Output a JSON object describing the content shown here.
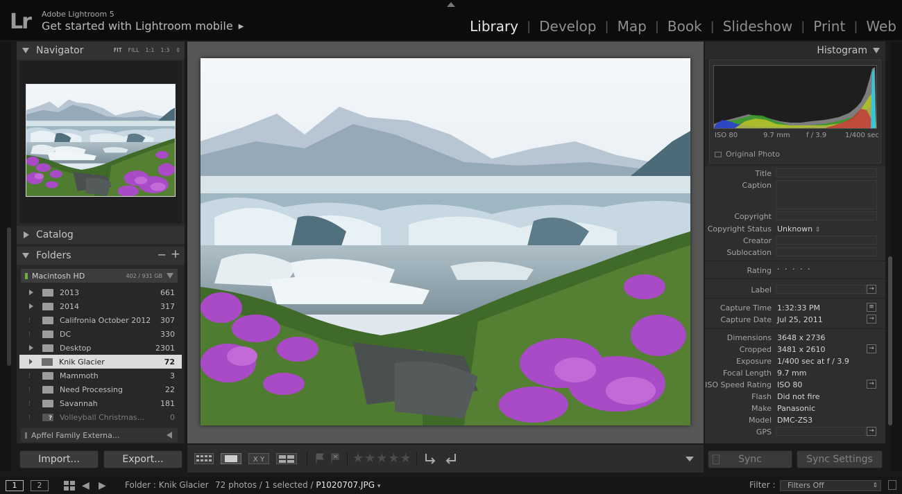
{
  "app": {
    "logo": "Lr",
    "version": "Adobe Lightroom 5",
    "mobile_link": "Get started with Lightroom mobile",
    "mobile_arrow": "▶"
  },
  "modules": {
    "library": "Library",
    "develop": "Develop",
    "map": "Map",
    "book": "Book",
    "slideshow": "Slideshow",
    "print": "Print",
    "web": "Web",
    "active": "Library"
  },
  "navigator": {
    "title": "Navigator",
    "zoom": [
      "FIT",
      "FILL",
      "1:1",
      "1:3"
    ],
    "zoom_active": "FIT"
  },
  "catalog": {
    "title": "Catalog"
  },
  "folders": {
    "title": "Folders",
    "minus": "−",
    "plus": "+",
    "volume": {
      "name": "Macintosh HD",
      "capacity": "402 / 931 GB"
    },
    "items": [
      {
        "name": "2013",
        "count": "661",
        "expandable": true
      },
      {
        "name": "2014",
        "count": "317",
        "expandable": true
      },
      {
        "name": "Califronia October 2012",
        "count": "307",
        "expandable": false
      },
      {
        "name": "DC",
        "count": "330",
        "expandable": false
      },
      {
        "name": "Desktop",
        "count": "2301",
        "expandable": true
      },
      {
        "name": "Knik Glacier",
        "count": "72",
        "expandable": false,
        "selected": true
      },
      {
        "name": "Mammoth",
        "count": "3",
        "expandable": false
      },
      {
        "name": "Need Processing",
        "count": "22",
        "expandable": false
      },
      {
        "name": "Savannah",
        "count": "181",
        "expandable": false
      },
      {
        "name": "Volleyball Christmas...",
        "count": "0",
        "expandable": false,
        "missing": true
      }
    ],
    "external": "Apffel Family Externa..."
  },
  "buttons": {
    "import": "Import...",
    "export": "Export...",
    "sync": "Sync",
    "sync_settings": "Sync Settings"
  },
  "histogram": {
    "title": "Histogram",
    "iso": "ISO 80",
    "focal": "9.7 mm",
    "aperture": "f / 3.9",
    "shutter": "1/400 sec",
    "original_photo": "Original Photo"
  },
  "metadata": {
    "title_label": "Title",
    "caption_label": "Caption",
    "copyright_label": "Copyright",
    "copyright_status_label": "Copyright Status",
    "copyright_status": "Unknown",
    "creator_label": "Creator",
    "sublocation_label": "Sublocation",
    "rating_label": "Rating",
    "rating": "· · · · ·",
    "label_label": "Label",
    "capture_time_label": "Capture Time",
    "capture_time": "1:32:33 PM",
    "capture_date_label": "Capture Date",
    "capture_date": "Jul 25, 2011",
    "dimensions_label": "Dimensions",
    "dimensions": "3648 x 2736",
    "cropped_label": "Cropped",
    "cropped": "3481 x 2610",
    "exposure_label": "Exposure",
    "exposure": "1/400 sec at f / 3.9",
    "focal_length_label": "Focal Length",
    "focal_length": "9.7 mm",
    "iso_label": "ISO Speed Rating",
    "iso": "ISO 80",
    "flash_label": "Flash",
    "flash": "Did not fire",
    "make_label": "Make",
    "make": "Panasonic",
    "model_label": "Model",
    "model": "DMC-ZS3",
    "gps_label": "GPS"
  },
  "toolbar": {
    "stars": "★★★★★"
  },
  "filmstrip": {
    "screen1": "1",
    "screen2": "2",
    "source": "Folder : Knik Glacier",
    "count": "72 photos / 1 selected /",
    "filename": "P1020707.JPG",
    "filter_label": "Filter :",
    "filter_value": "Filters Off"
  }
}
